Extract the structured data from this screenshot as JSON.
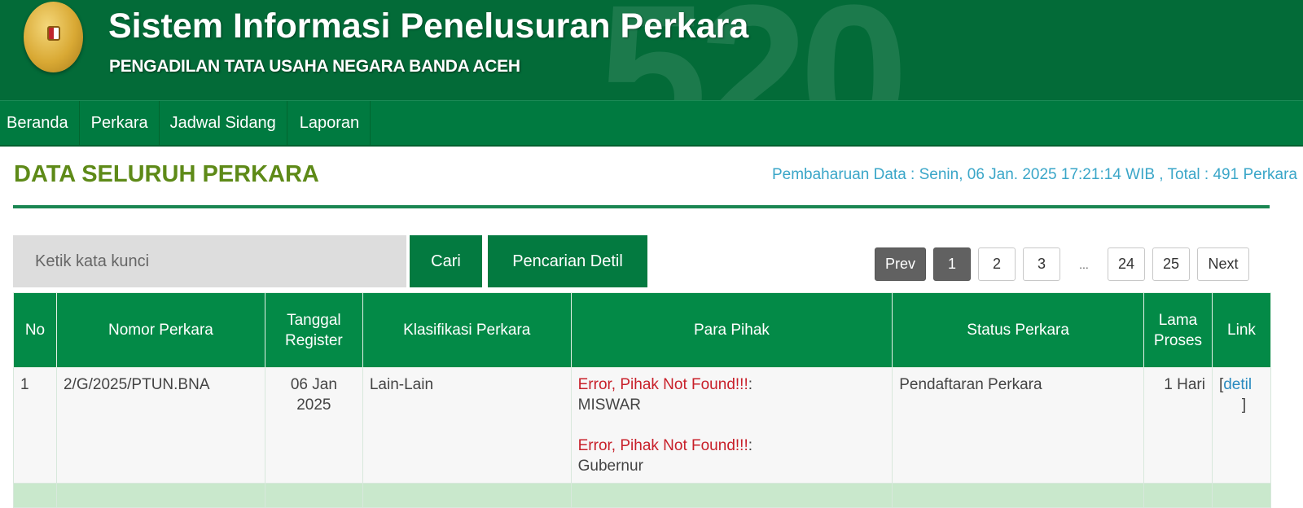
{
  "header": {
    "title": "Sistem Informasi Penelusuran Perkara",
    "subtitle": "PENGADILAN TATA USAHA NEGARA BANDA ACEH",
    "watermark": "520",
    "logo_icon": "court-emblem-logo"
  },
  "nav": {
    "items": [
      {
        "label": "Beranda"
      },
      {
        "label": "Perkara"
      },
      {
        "label": "Jadwal Sidang"
      },
      {
        "label": "Laporan"
      }
    ]
  },
  "page": {
    "title": "DATA SELURUH PERKARA",
    "update_info": "Pembaharuan Data : Senin, 06 Jan. 2025 17:21:14 WIB , Total : 491 Perkara"
  },
  "search": {
    "placeholder": "Ketik kata kunci",
    "value": "",
    "search_button": "Cari",
    "detail_button": "Pencarian Detil"
  },
  "pagination": {
    "prev": "Prev",
    "pages": [
      "1",
      "2",
      "3"
    ],
    "ellipsis": "...",
    "last_pages": [
      "24",
      "25"
    ],
    "next": "Next",
    "current": "1"
  },
  "table": {
    "columns": [
      {
        "label": "No"
      },
      {
        "label": "Nomor Perkara"
      },
      {
        "label": "Tanggal Register"
      },
      {
        "label": "Klasifikasi Perkara"
      },
      {
        "label": "Para Pihak"
      },
      {
        "label": "Status Perkara"
      },
      {
        "label": "Lama Proses"
      },
      {
        "label": "Link"
      }
    ],
    "rows": [
      {
        "no": "1",
        "nomor": "2/G/2025/PTUN.BNA",
        "tanggal_line1": "06 Jan",
        "tanggal_line2": "2025",
        "klasifikasi": "Lain-Lain",
        "pihak": [
          {
            "error": "Error, Pihak Not Found!!!",
            "sep": ":",
            "name": "MISWAR"
          },
          {
            "error": "Error, Pihak Not Found!!!",
            "sep": ":",
            "name": "Gubernur"
          }
        ],
        "status": "Pendaftaran Perkara",
        "lama": "1 Hari",
        "link_open": "[",
        "link_label": "detil",
        "link_close": "]"
      }
    ]
  },
  "colors": {
    "header_bg": "#036b38",
    "nav_bg": "#007a40",
    "title_green": "#5e8a18",
    "info_blue": "#3aa6c8",
    "error_red": "#c8202a",
    "table_header": "#038a47"
  }
}
